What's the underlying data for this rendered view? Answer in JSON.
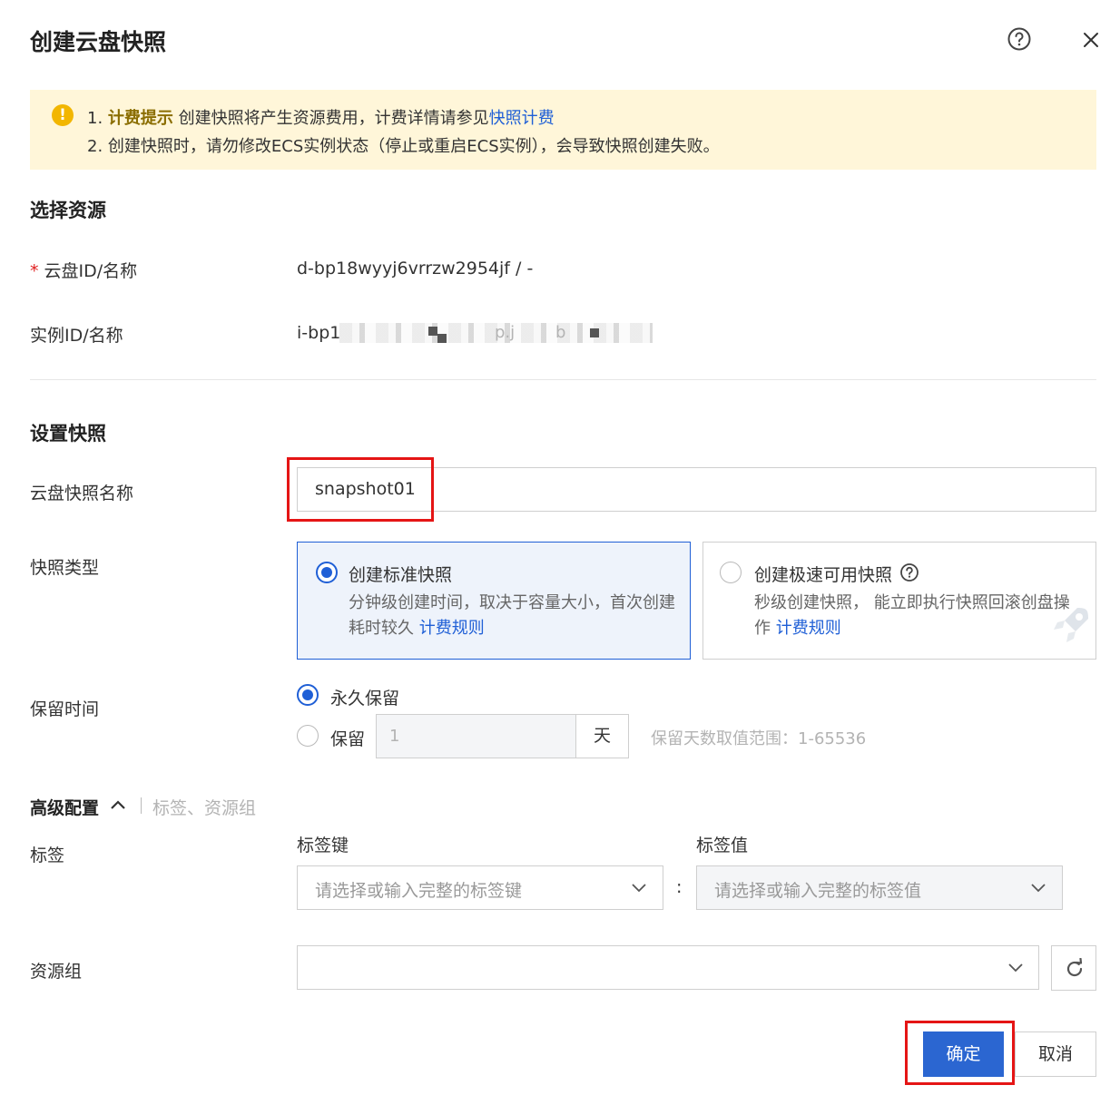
{
  "dialog": {
    "title": "创建云盘快照"
  },
  "notice": {
    "line1_prefix": "1. ",
    "line1_highlight": "计费提示",
    "line1_text": " 创建快照将产生资源费用，计费详情请参见",
    "line1_link": "快照计费",
    "line2": "2. 创建快照时，请勿修改ECS实例状态（停止或重启ECS实例），会导致快照创建失败。"
  },
  "resource": {
    "section_title": "选择资源",
    "disk_label": "云盘ID/名称",
    "disk_required_mark": "*",
    "disk_value": "d-bp18wyyj6vrrzw2954jf / -",
    "instance_label": "实例ID/名称",
    "instance_value_visible": "i-bp1",
    "instance_value_tail": "p.j",
    "instance_value_tail2": "b"
  },
  "snapshot": {
    "section_title": "设置快照",
    "name_label": "云盘快照名称",
    "name_value": "snapshot01",
    "type_label": "快照类型",
    "types": [
      {
        "title": "创建标准快照",
        "desc": "分钟级创建时间，取决于容量大小，首次创建耗时较久",
        "link": "计费规则",
        "selected": true
      },
      {
        "title": "创建极速可用快照",
        "desc": "秒级创建快照， 能立即执行快照回滚创盘操作",
        "link": "计费规则",
        "selected": false
      }
    ],
    "retention_label": "保留时间",
    "retention_forever": "永久保留",
    "retention_days_label": "保留",
    "retention_days_value": "1",
    "retention_unit": "天",
    "retention_hint": "保留天数取值范围：1-65536"
  },
  "advanced": {
    "title": "高级配置",
    "summary": "标签、资源组",
    "tags_label": "标签",
    "tag_key_label": "标签键",
    "tag_value_label": "标签值",
    "tag_key_placeholder": "请选择或输入完整的标签键",
    "tag_value_placeholder": "请选择或输入完整的标签值",
    "separator": ":",
    "resource_group_label": "资源组",
    "resource_group_value": ""
  },
  "footer": {
    "confirm": "确定",
    "cancel": "取消"
  },
  "colors": {
    "primary": "#2b66d1",
    "link": "#1f5fd6",
    "notice_bg": "#fff6d9",
    "warning": "#f2b600",
    "highlight_box": "#e51515"
  }
}
